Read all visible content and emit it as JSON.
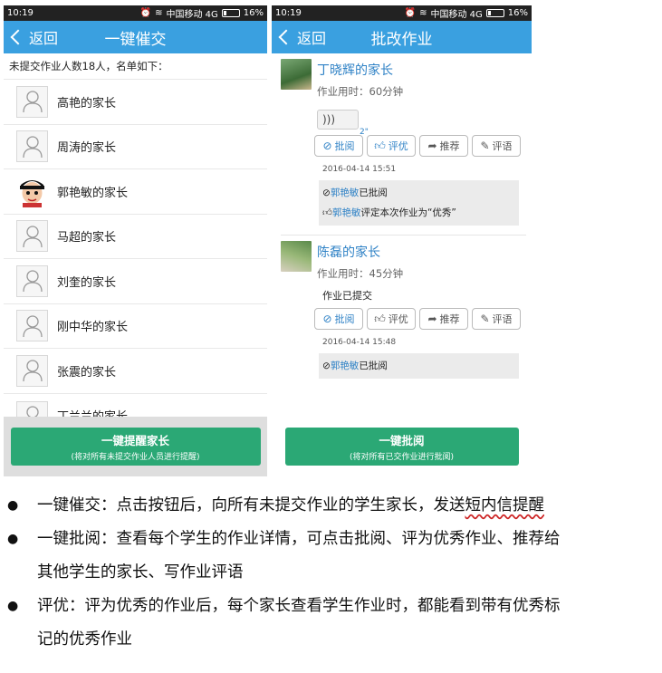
{
  "status_bar": {
    "time": "10:19",
    "carrier": "中国移动 4G",
    "battery": "16%"
  },
  "screen1": {
    "back_label": "返回",
    "title": "一键催交",
    "info": "未提交作业人数18人，名单如下：",
    "people": [
      "高艳的家长",
      "周涛的家长",
      "郭艳敏的家长",
      "马超的家长",
      "刘奎的家长",
      "刚中华的家长",
      "张震的家长",
      "丁兰兰的家长"
    ],
    "button_title": "一键提醒家长",
    "button_sub": "(将对所有未提交作业人员进行提醒)"
  },
  "screen2": {
    "back_label": "返回",
    "title": "批改作业",
    "actions": {
      "review": "批阅",
      "excellent": "评优",
      "recommend": "推荐",
      "comment": "评语"
    },
    "entries": [
      {
        "name": "丁晓辉的家长",
        "time_used": "作业用时：60分钟",
        "voice_duration": "2\"",
        "date": "2016-04-14 15:51",
        "reviewer": "郭艳敏",
        "review_text": "已批阅",
        "excellent_reviewer": "郭艳敏",
        "excellent_text": "评定本次作业为“优秀”"
      },
      {
        "name": "陈磊的家长",
        "time_used": "作业用时：45分钟",
        "submitted": "作业已提交",
        "date": "2016-04-14 15:48",
        "reviewer": "郭艳敏",
        "review_text": "已批阅"
      }
    ],
    "button_title": "一键批阅",
    "button_sub": "(将对所有已交作业进行批阅)"
  },
  "bullets": {
    "b1_prefix": "一键催交：点击按钮后，向所有未提交作业的学生家长，发送",
    "b1_underlined": "短内信提醒",
    "b2_line1": "一键批阅：查看每个学生的作业详情，可点击批阅、评为优秀作业、推荐给",
    "b2_line2": "其他学生的家长、写作业评语",
    "b3_line1": "评优：评为优秀的作业后，每个家长查看学生作业时，都能看到带有优秀标",
    "b3_line2": "记的优秀作业"
  }
}
